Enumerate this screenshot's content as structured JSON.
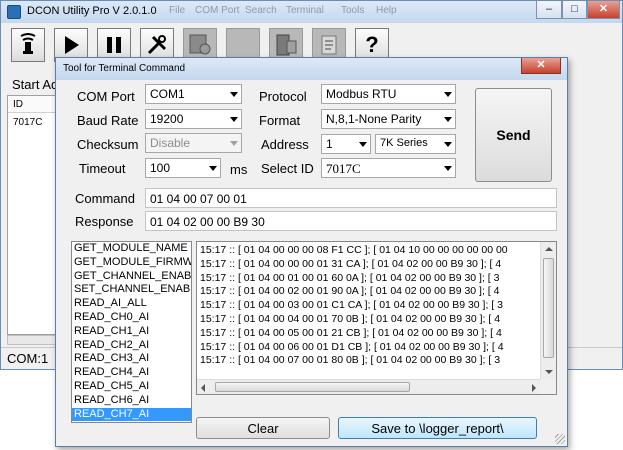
{
  "main_window": {
    "title": "DCON Utility Pro V 2.0.1.0",
    "menu_ghost": [
      "File",
      "COM Port",
      "Search",
      "Terminal",
      "Tools",
      "Help"
    ],
    "min_label": "–",
    "max_label": "□",
    "close_label": "✕",
    "toolbar": [
      {
        "name": "search",
        "icon": "antenna-icon"
      },
      {
        "name": "start",
        "icon": "play-icon"
      },
      {
        "name": "pause",
        "icon": "pause-icon"
      },
      {
        "name": "config",
        "icon": "tools-icon"
      },
      {
        "name": "terminal",
        "icon": "terminal-icon"
      },
      {
        "name": "blank",
        "icon": "blank-icon"
      },
      {
        "name": "module-config",
        "icon": "module-icon"
      },
      {
        "name": "report",
        "icon": "report-icon"
      },
      {
        "name": "help",
        "icon": "help-icon",
        "label": "?"
      }
    ],
    "start_label": "Start Add",
    "table_header_id": "ID",
    "rows": [
      "7017C"
    ],
    "status": "COM:1"
  },
  "dialog": {
    "title": "Tool for Terminal Command",
    "close_label": "✕",
    "labels": {
      "com_port": "COM Port",
      "baud_rate": "Baud Rate",
      "checksum": "Checksum",
      "timeout": "Timeout",
      "timeout_unit": "ms",
      "protocol": "Protocol",
      "format": "Format",
      "address": "Address",
      "select_id": "Select ID",
      "command": "Command",
      "response": "Response"
    },
    "values": {
      "com_port": "COM1",
      "baud_rate": "19200",
      "checksum": "Disable",
      "timeout": "100",
      "protocol": "Modbus RTU",
      "format": "N,8,1-None Parity",
      "address": "1",
      "series": "7K Series",
      "select_id": "7017C",
      "command": "01 04 00 07 00 01",
      "response": "01 04 02 00 00 B9 30"
    },
    "send_label": "Send",
    "commands": [
      "GET_MODULE_NAME",
      "GET_MODULE_FIRMW",
      "GET_CHANNEL_ENABL",
      "SET_CHANNEL_ENABL",
      "READ_AI_ALL",
      "READ_CH0_AI",
      "READ_CH1_AI",
      "READ_CH2_AI",
      "READ_CH3_AI",
      "READ_CH4_AI",
      "READ_CH5_AI",
      "READ_CH6_AI",
      "READ_CH7_AI"
    ],
    "selected_command": "READ_CH7_AI",
    "log": [
      "15:17 :: [ 01 04 00 00 00 08 F1 CC ]; [ 01 04 10 00 00 00 00 00 00",
      "15:17 :: [ 01 04 00 00 00 01 31 CA ]; [ 01 04 02 00 00 B9 30  ]; [ 4",
      "15:17 :: [ 01 04 00 01 00 01 60 0A ]; [ 01 04 02 00 00 B9 30  ]; [ 3",
      "15:17 :: [ 01 04 00 02 00 01 90 0A ]; [ 01 04 02 00 00 B9 30  ]; [ 4",
      "15:17 :: [ 01 04 00 03 00 01 C1 CA ]; [ 01 04 02 00 00 B9 30  ]; [ 3",
      "15:17 :: [ 01 04 00 04 00 01 70 0B ]; [ 01 04 02 00 00 B9 30  ]; [ 4",
      "15:17 :: [ 01 04 00 05 00 01 21 CB ]; [ 01 04 02 00 00 B9 30  ]; [ 4",
      "15:17 :: [ 01 04 00 06 00 01 D1 CB ]; [ 01 04 02 00 00 B9 30  ]; [ 4",
      "15:17 :: [ 01 04 00 07 00 01 80 0B ]; [ 01 04 02 00 00 B9 30  ]; [ 3"
    ],
    "clear_label": "Clear",
    "save_label": "Save to \\logger_report\\"
  }
}
